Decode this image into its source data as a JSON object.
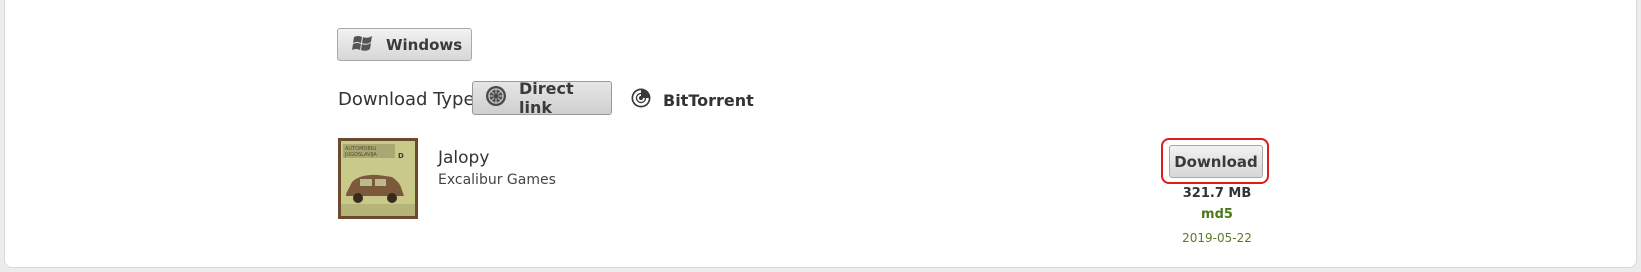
{
  "platform": {
    "label": "Windows",
    "icon": "windows-icon"
  },
  "download_type": {
    "label": "Download Type:",
    "options": [
      {
        "label": "Direct link",
        "icon": "direct-link-icon",
        "selected": true
      },
      {
        "label": "BitTorrent",
        "icon": "bittorrent-icon",
        "selected": false
      }
    ]
  },
  "item": {
    "title": "Jalopy",
    "developer": "Excalibur Games",
    "download_label": "Download",
    "size": "321.7 MB",
    "md5_label": "md5",
    "date": "2019-05-22"
  },
  "colors": {
    "highlight": "#e01b1b",
    "md5": "#4a7a1a",
    "date": "#5a7a2a"
  }
}
